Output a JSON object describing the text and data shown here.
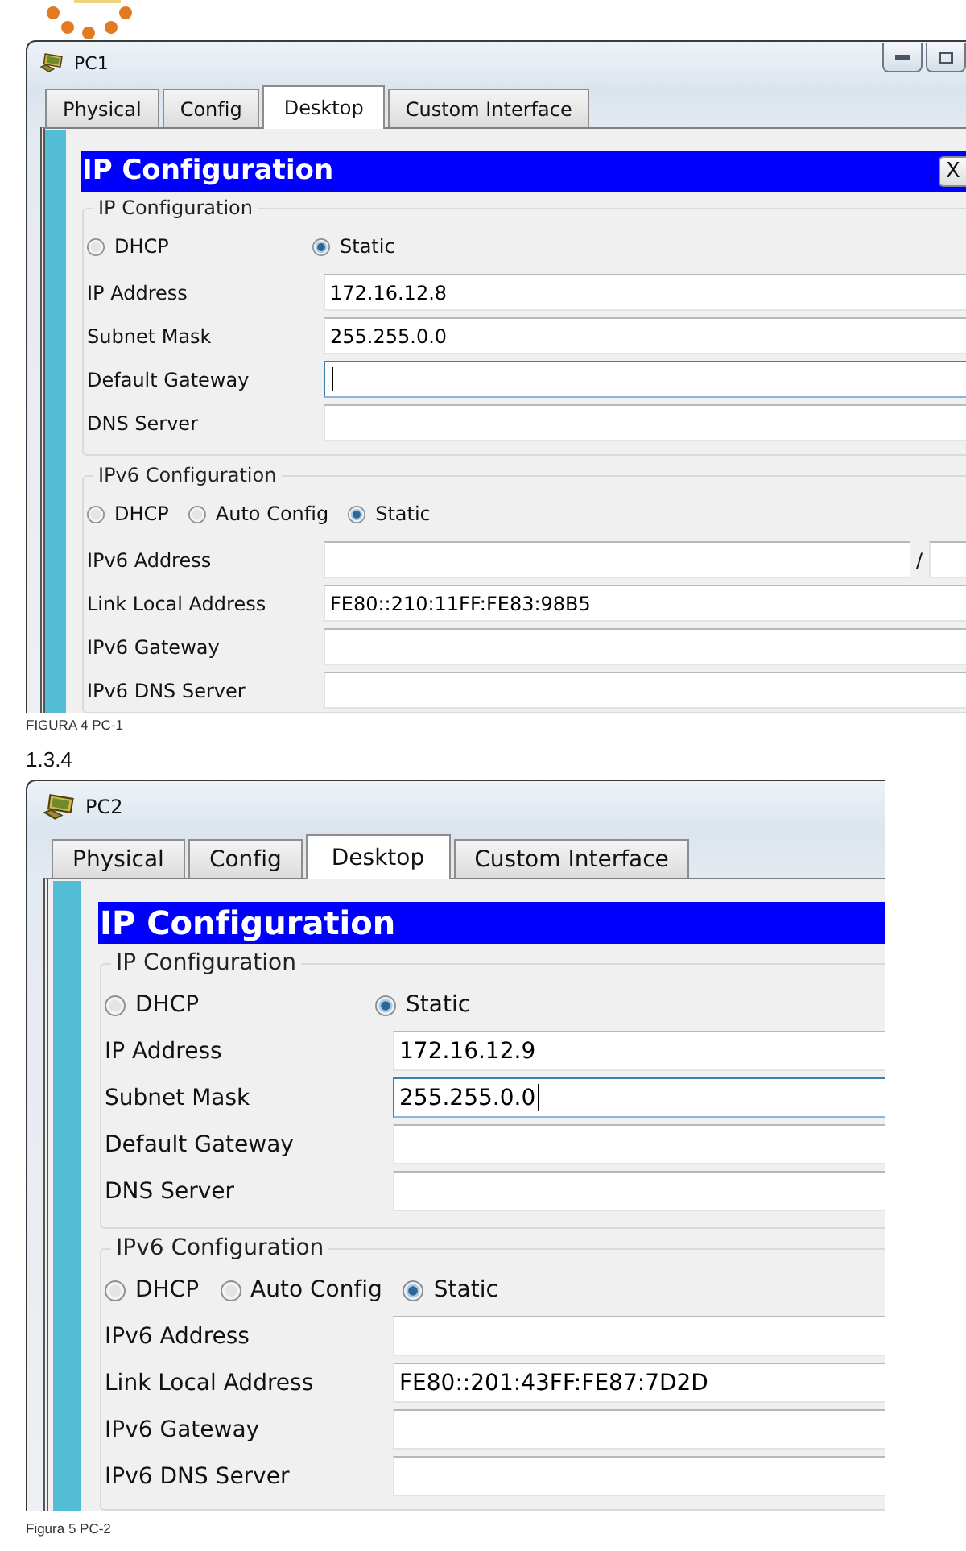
{
  "figures": [
    {
      "window": {
        "title": "PC1",
        "title_buttons": true
      },
      "tabs": [
        {
          "label": "Physical",
          "selected": false
        },
        {
          "label": "Config",
          "selected": false
        },
        {
          "label": "Desktop",
          "selected": true
        },
        {
          "label": "Custom Interface",
          "selected": false
        }
      ],
      "dialog": {
        "title": "IP Configuration",
        "close_label": "X"
      },
      "groups": [
        {
          "kind": "ipv4",
          "legend": "IP Configuration",
          "modes": [
            {
              "label": "DHCP",
              "selected": false
            },
            {
              "label": "Static",
              "selected": true
            }
          ],
          "fields": [
            {
              "kind": "text",
              "label": "IP Address",
              "value": "172.16.12.8",
              "focused": false
            },
            {
              "kind": "text",
              "label": "Subnet Mask",
              "value": "255.255.0.0",
              "focused": false
            },
            {
              "kind": "text",
              "label": "Default Gateway",
              "focused": true
            },
            {
              "kind": "text",
              "label": "DNS Server",
              "focused": false
            }
          ]
        },
        {
          "kind": "ipv6",
          "legend": "IPv6 Configuration",
          "modes": [
            {
              "label": "DHCP",
              "selected": false
            },
            {
              "label": "Auto Config",
              "selected": false
            },
            {
              "label": "Static",
              "selected": true
            }
          ],
          "fields": [
            {
              "kind": "prefix",
              "label": "IPv6 Address",
              "separator": "/",
              "focused": false
            },
            {
              "kind": "text",
              "label": "Link Local Address",
              "value": "FE80::210:11FF:FE83:98B5",
              "focused": false
            },
            {
              "kind": "text",
              "label": "IPv6 Gateway",
              "focused": false
            },
            {
              "kind": "text",
              "label": "IPv6 DNS Server",
              "focused": false
            }
          ]
        }
      ],
      "caption": "FIGURA 4 PC-1"
    },
    {
      "heading": "1.3.4",
      "window": {
        "title": "PC2"
      },
      "tabs": [
        {
          "label": "Physical",
          "selected": false
        },
        {
          "label": "Config",
          "selected": false
        },
        {
          "label": "Desktop",
          "selected": true
        },
        {
          "label": "Custom Interface",
          "selected": false
        }
      ],
      "dialog": {
        "title": "IP Configuration"
      },
      "groups": [
        {
          "kind": "ipv4",
          "legend": "IP Configuration",
          "modes": [
            {
              "label": "DHCP",
              "selected": false
            },
            {
              "label": "Static",
              "selected": true
            }
          ],
          "fields": [
            {
              "kind": "text",
              "label": "IP Address",
              "value": "172.16.12.9",
              "focused": false
            },
            {
              "kind": "text",
              "label": "Subnet Mask",
              "value": "255.255.0.0",
              "focused": true
            },
            {
              "kind": "text",
              "label": "Default Gateway",
              "focused": false
            },
            {
              "kind": "text",
              "label": "DNS Server",
              "focused": false
            }
          ]
        },
        {
          "kind": "ipv6",
          "legend": "IPv6 Configuration",
          "modes": [
            {
              "label": "DHCP",
              "selected": false
            },
            {
              "label": "Auto Config",
              "selected": false
            },
            {
              "label": "Static",
              "selected": true
            }
          ],
          "fields": [
            {
              "kind": "text",
              "label": "IPv6 Address",
              "focused": false
            },
            {
              "kind": "text",
              "label": "Link Local Address",
              "value": "FE80::201:43FF:FE87:7D2D",
              "focused": false
            },
            {
              "kind": "text",
              "label": "IPv6 Gateway",
              "focused": false
            },
            {
              "kind": "text",
              "label": "IPv6 DNS Server",
              "focused": false
            }
          ]
        }
      ],
      "caption": "Figura 5 PC-2"
    }
  ]
}
